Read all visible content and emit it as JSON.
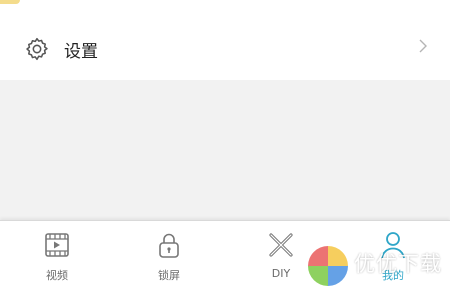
{
  "settings": {
    "label": "设置",
    "icon": "gear-icon"
  },
  "tabbar": {
    "items": [
      {
        "label": "视频",
        "icon": "video-icon",
        "active": false
      },
      {
        "label": "锁屏",
        "icon": "lock-icon",
        "active": false
      },
      {
        "label": "DIY",
        "icon": "brush-tools-icon",
        "active": false
      },
      {
        "label": "我的",
        "icon": "person-icon",
        "active": true
      }
    ]
  },
  "watermark": {
    "text": "优优下载"
  },
  "colors": {
    "active": "#2fa6c8",
    "inactive": "#6b6b6b",
    "background": "#f2f2f2"
  }
}
